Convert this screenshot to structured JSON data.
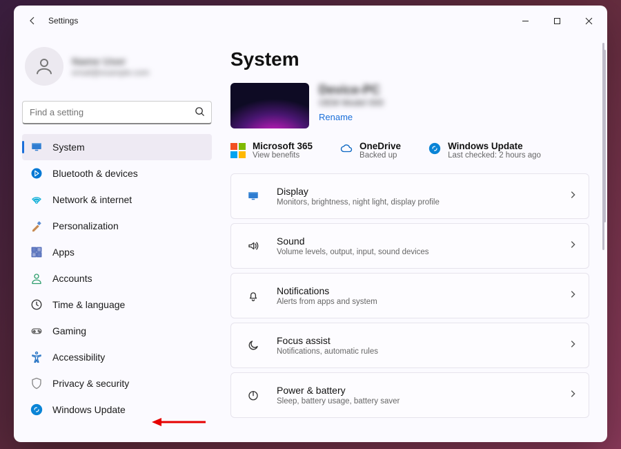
{
  "window": {
    "title": "Settings"
  },
  "account": {
    "name_masked": "Name User",
    "email_masked": "email@example.com"
  },
  "search": {
    "placeholder": "Find a setting"
  },
  "sidebar": {
    "items": [
      {
        "id": "system",
        "label": "System",
        "selected": true,
        "icon": "monitor"
      },
      {
        "id": "bluetooth",
        "label": "Bluetooth & devices",
        "icon": "bluetooth",
        "color": "#0078d4"
      },
      {
        "id": "network",
        "label": "Network & internet",
        "icon": "wifi",
        "color": "#14b0d8"
      },
      {
        "id": "personalization",
        "label": "Personalization",
        "icon": "brush",
        "color": "#c06a2c"
      },
      {
        "id": "apps",
        "label": "Apps",
        "icon": "apps",
        "color": "#4f6ab8"
      },
      {
        "id": "accounts",
        "label": "Accounts",
        "icon": "person",
        "color": "#2e9e6d"
      },
      {
        "id": "time",
        "label": "Time & language",
        "icon": "clock",
        "color": "#333"
      },
      {
        "id": "gaming",
        "label": "Gaming",
        "icon": "gamepad",
        "color": "#666"
      },
      {
        "id": "accessibility",
        "label": "Accessibility",
        "icon": "accessibility",
        "color": "#1f6fc2"
      },
      {
        "id": "privacy",
        "label": "Privacy & security",
        "icon": "shield",
        "color": "#888"
      },
      {
        "id": "windowsupdate",
        "label": "Windows Update",
        "icon": "update",
        "color": "#0a84d6"
      }
    ]
  },
  "main": {
    "heading": "System",
    "pc": {
      "name_masked": "Device-PC",
      "model_masked": "OEM Model 000",
      "rename": "Rename"
    },
    "status": [
      {
        "id": "m365",
        "label": "Microsoft 365",
        "sub": "View benefits",
        "icon": "m365"
      },
      {
        "id": "onedrive",
        "label": "OneDrive",
        "sub": "Backed up",
        "icon": "cloud",
        "color": "#0a66c2"
      },
      {
        "id": "winupdate",
        "label": "Windows Update",
        "sub": "Last checked: 2 hours ago",
        "icon": "update",
        "color": "#0a84d6"
      }
    ],
    "cards": [
      {
        "id": "display",
        "title": "Display",
        "sub": "Monitors, brightness, night light, display profile",
        "icon": "monitor"
      },
      {
        "id": "sound",
        "title": "Sound",
        "sub": "Volume levels, output, input, sound devices",
        "icon": "sound"
      },
      {
        "id": "notifications",
        "title": "Notifications",
        "sub": "Alerts from apps and system",
        "icon": "bell"
      },
      {
        "id": "focus",
        "title": "Focus assist",
        "sub": "Notifications, automatic rules",
        "icon": "moon"
      },
      {
        "id": "power",
        "title": "Power & battery",
        "sub": "Sleep, battery usage, battery saver",
        "icon": "power"
      }
    ]
  },
  "annotation": {
    "arrow_target": "windowsupdate"
  }
}
